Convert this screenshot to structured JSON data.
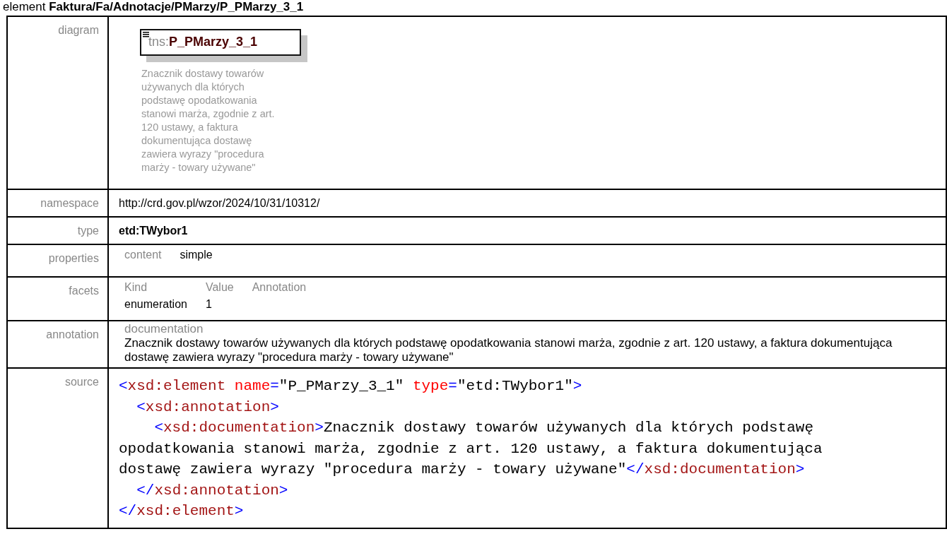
{
  "heading": "element **Faktura/Fa/Adnotacje/PMarzy/P_PMarzy_3_1**",
  "rows": [
    {
      "label": "diagram",
      "kind": "diagram",
      "prefix": "tns:",
      "name": "P_PMarzy_3_1",
      "description": "Znacznik dostawy towarów używanych dla których podstawę opodatkowania stanowi marża, zgodnie z art. 120 ustawy, a faktura dokumentująca dostawę zawiera wyrazy \"procedura marży - towary używane\""
    },
    {
      "label": "namespace",
      "kind": "text",
      "value": "http://crd.gov.pl/wzor/2024/10/31/10312/"
    },
    {
      "label": "type",
      "kind": "bold",
      "value": "etd:TWybor1"
    },
    {
      "label": "properties",
      "kind": "properties",
      "items": [
        {
          "key": "content",
          "value": "simple"
        }
      ]
    },
    {
      "label": "facets",
      "kind": "facets",
      "columns": [
        "Kind",
        "Value",
        "Annotation"
      ],
      "rows": [
        [
          "enumeration",
          "1"
        ]
      ]
    },
    {
      "label": "annotation",
      "kind": "annotation",
      "title": "documentation",
      "text": "Znacznik dostawy towarów używanych dla których podstawę opodatkowania stanowi marża, zgodnie z art. 120 ustawy, a faktura dokumentująca dostawę zawiera wyrazy \"procedura marży - towary używane\""
    },
    {
      "label": "source",
      "kind": "source",
      "nodes": [
        {
          "open": [
            "<",
            "xsd:element",
            " name",
            "=",
            "\"P_PMarzy_3_1\"",
            " type",
            "=",
            "\"etd:TWybor1\"",
            ">"
          ],
          "children": [
            {
              "open": [
                "<",
                "xsd:annotation",
                ">"
              ],
              "children": [
                {
                  "open": [
                    "<",
                    "xsd:documentation",
                    ">",
                    "Znacznik dostawy towarów używanych dla których podstawę opodatkowania stanowi marża, zgodnie z art. 120 ustawy, a faktura dokumentująca dostawę zawiera wyrazy \"procedura marży - towary używane\"",
                    "</",
                    "xsd:documentation",
                    ">"
                  ]
                }
              ],
              "close": [
                "</",
                "xsd:annotation",
                ">"
              ]
            }
          ],
          "close": [
            "</",
            "xsd:element",
            ">"
          ]
        }
      ]
    }
  ]
}
